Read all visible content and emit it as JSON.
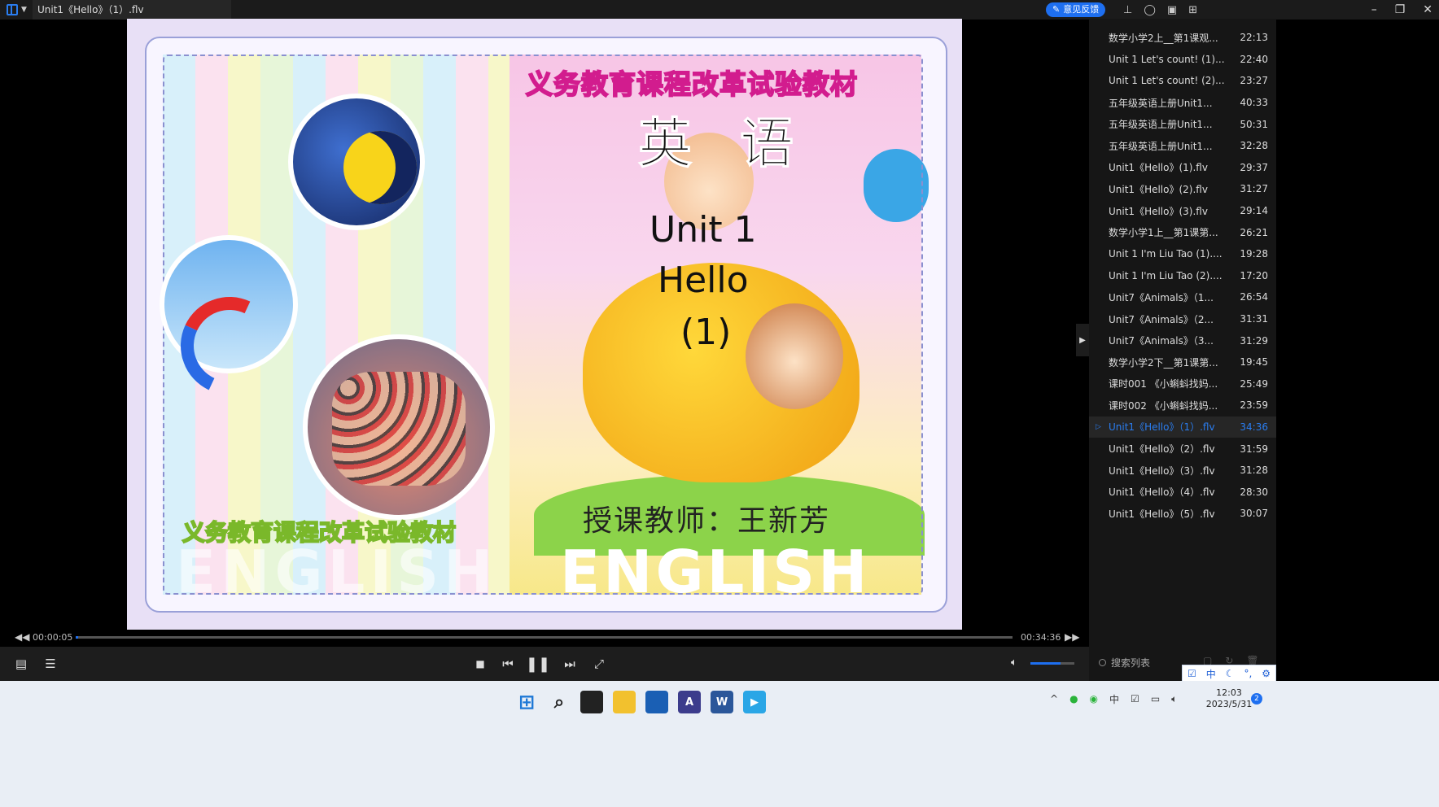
{
  "titlebar": {
    "title": "Unit1《Hello》（1）.flv",
    "feedback_label": "意见反馈"
  },
  "video": {
    "top_title": "义务教育课程改革试验教材",
    "subject": "英 语",
    "unit_line": "Unit 1",
    "hello_line": "Hello",
    "part_line": "(1)",
    "bottom_title": "义务教育课程改革试验教材",
    "teacher": "授课教师：王新芳",
    "english_left": "ENGLISH",
    "english_right": "ENGLISH"
  },
  "progress": {
    "current_time": "00:00:05",
    "total_time": "00:34:36",
    "fraction": 0.0024
  },
  "volume": {
    "fraction": 0.68
  },
  "playlist": {
    "items": [
      {
        "name": "数学小学2上__第1课观...",
        "duration": "22:13"
      },
      {
        "name": "Unit 1 Let's count! (1)...",
        "duration": "22:40"
      },
      {
        "name": "Unit 1 Let's count! (2)...",
        "duration": "23:27"
      },
      {
        "name": "五年级英语上册Unit1...",
        "duration": "40:33"
      },
      {
        "name": "五年级英语上册Unit1...",
        "duration": "50:31"
      },
      {
        "name": "五年级英语上册Unit1...",
        "duration": "32:28"
      },
      {
        "name": "Unit1《Hello》(1).flv",
        "duration": "29:37"
      },
      {
        "name": "Unit1《Hello》(2).flv",
        "duration": "31:27"
      },
      {
        "name": "Unit1《Hello》(3).flv",
        "duration": "29:14"
      },
      {
        "name": "数学小学1上__第1课第...",
        "duration": "26:21"
      },
      {
        "name": "Unit 1 I'm Liu Tao (1)....",
        "duration": "19:28"
      },
      {
        "name": "Unit 1 I'm Liu Tao (2)....",
        "duration": "17:20"
      },
      {
        "name": "Unit7《Animals》（1...",
        "duration": "26:54"
      },
      {
        "name": "Unit7《Animals》（2...",
        "duration": "31:31"
      },
      {
        "name": "Unit7《Animals》（3...",
        "duration": "31:29"
      },
      {
        "name": "数学小学2下__第1课第...",
        "duration": "19:45"
      },
      {
        "name": "课时001 《小蝌蚪找妈...",
        "duration": "25:49"
      },
      {
        "name": "课时002 《小蝌蚪找妈...",
        "duration": "23:59"
      },
      {
        "name": "Unit1《Hello》（1）.flv",
        "duration": "34:36"
      },
      {
        "name": "Unit1《Hello》（2）.flv",
        "duration": "31:59"
      },
      {
        "name": "Unit1《Hello》（3）.flv",
        "duration": "31:28"
      },
      {
        "name": "Unit1《Hello》（4）.flv",
        "duration": "28:30"
      },
      {
        "name": "Unit1《Hello》（5）.flv",
        "duration": "30:07"
      }
    ],
    "active_index": 18,
    "search_placeholder": "搜索列表"
  },
  "ime": {
    "lang": "中"
  },
  "taskbar": {
    "time": "12:03",
    "date": "2023/5/31",
    "notification_count": "2",
    "tray_lang": "中"
  },
  "colors": {
    "accent": "#1e6ff0"
  }
}
